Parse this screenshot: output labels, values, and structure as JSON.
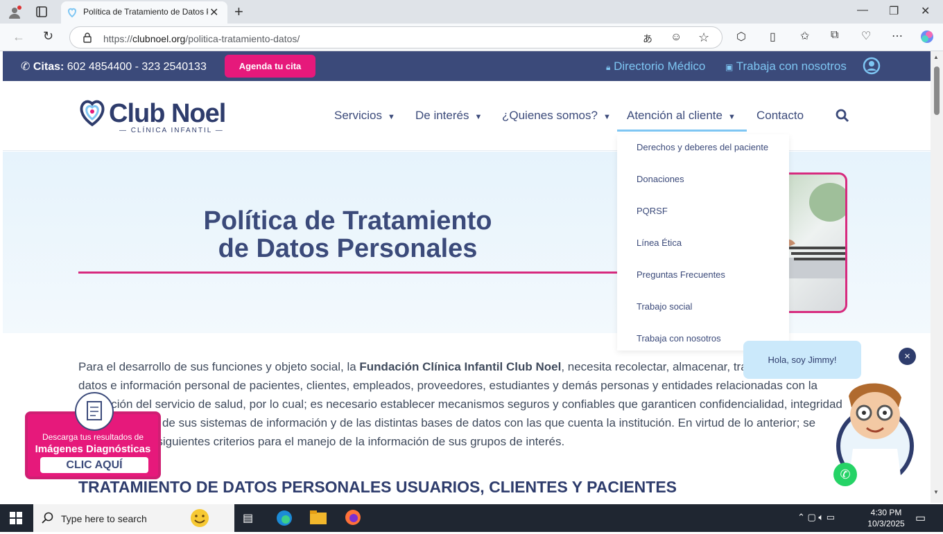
{
  "browser": {
    "tab_title": "Política de Tratamiento de Datos P",
    "url_domain": "clubnoel.org",
    "url_prefix": "https://",
    "url_path": "/politica-tratamiento-datos/"
  },
  "topbar": {
    "phone_label": "Citas:",
    "phone_numbers": "602 4854400 - 323 2540133",
    "cta": "Agenda tu cita",
    "link_directorio": "Directorio Médico",
    "link_trabaja": "Trabaja con nosotros"
  },
  "header": {
    "logo_main": "Club Noel",
    "logo_sub": "— CLÍNICA INFANTIL —",
    "nav": {
      "servicios": "Servicios",
      "interes": "De interés",
      "quienes": "¿Quienes somos?",
      "atencion": "Atención al cliente",
      "contacto": "Contacto"
    }
  },
  "dropdown": {
    "items": [
      "Derechos y deberes del paciente",
      "Donaciones",
      "PQRSF",
      "Línea Ética",
      "Preguntas Frecuentes",
      "Trabajo social",
      "Trabaja con nosotros"
    ]
  },
  "hero": {
    "title_line1": "Política de Tratamiento",
    "title_line2": "de Datos Personales"
  },
  "content": {
    "p1_start": "Para el desarrollo de sus funciones y objeto social, la ",
    "p1_bold": "Fundación Clínica Infantil Club Noel",
    "p1_end": ", necesita recolectar, almacenar, tratar y disponer de datos e información personal de pacientes, clientes, empleados, proveedores, estudiantes y demás personas y entidades relacionadas con la prestación del servicio de salud, por lo cual; es necesario establecer mecanismos seguros y confiables que garanticen confidencialidad, integridad y disponibilidad de sus sistemas de información y de las distintas bases de datos con las que cuenta la institución. En virtud de lo anterior; se establecen los siguientes criterios para el manejo de la información de sus grupos de interés.",
    "subhead": "TRATAMIENTO DE DATOS PERSONALES USUARIOS, CLIENTES Y PACIENTES"
  },
  "banner": {
    "line1": "Descarga tus resultados de",
    "line2": "Imágenes Diagnósticas",
    "button": "CLIC AQUÍ"
  },
  "chat": {
    "greeting": "Hola, soy Jimmy!",
    "close": "×"
  },
  "taskbar": {
    "search_placeholder": "Type here to search",
    "time": "4:30 PM",
    "date": "10/3/2025"
  },
  "colors": {
    "navy": "#3b4a7a",
    "pink": "#e6197b",
    "light_blue": "#7ec6f3"
  }
}
